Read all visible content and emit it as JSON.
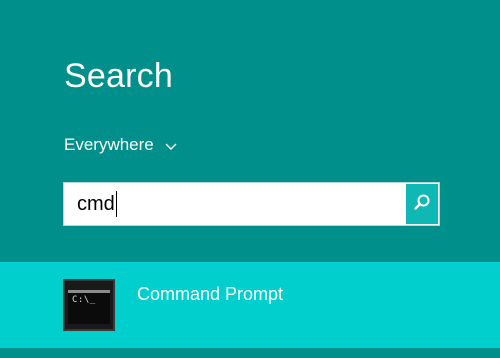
{
  "search_pane": {
    "title": "Search",
    "scope": {
      "label": "Everywhere",
      "icon": "chevron-down-icon"
    },
    "search_box": {
      "value": "cmd",
      "button_icon": "search-icon"
    }
  },
  "results": [
    {
      "label": "Command Prompt",
      "icon": "command-prompt-icon",
      "icon_text": "C:\\_"
    }
  ],
  "colors": {
    "pane_background": "#008f8a",
    "selected_result_background": "#00cfcd",
    "search_button_background": "#0fb8b4",
    "text": "#ffffff"
  }
}
